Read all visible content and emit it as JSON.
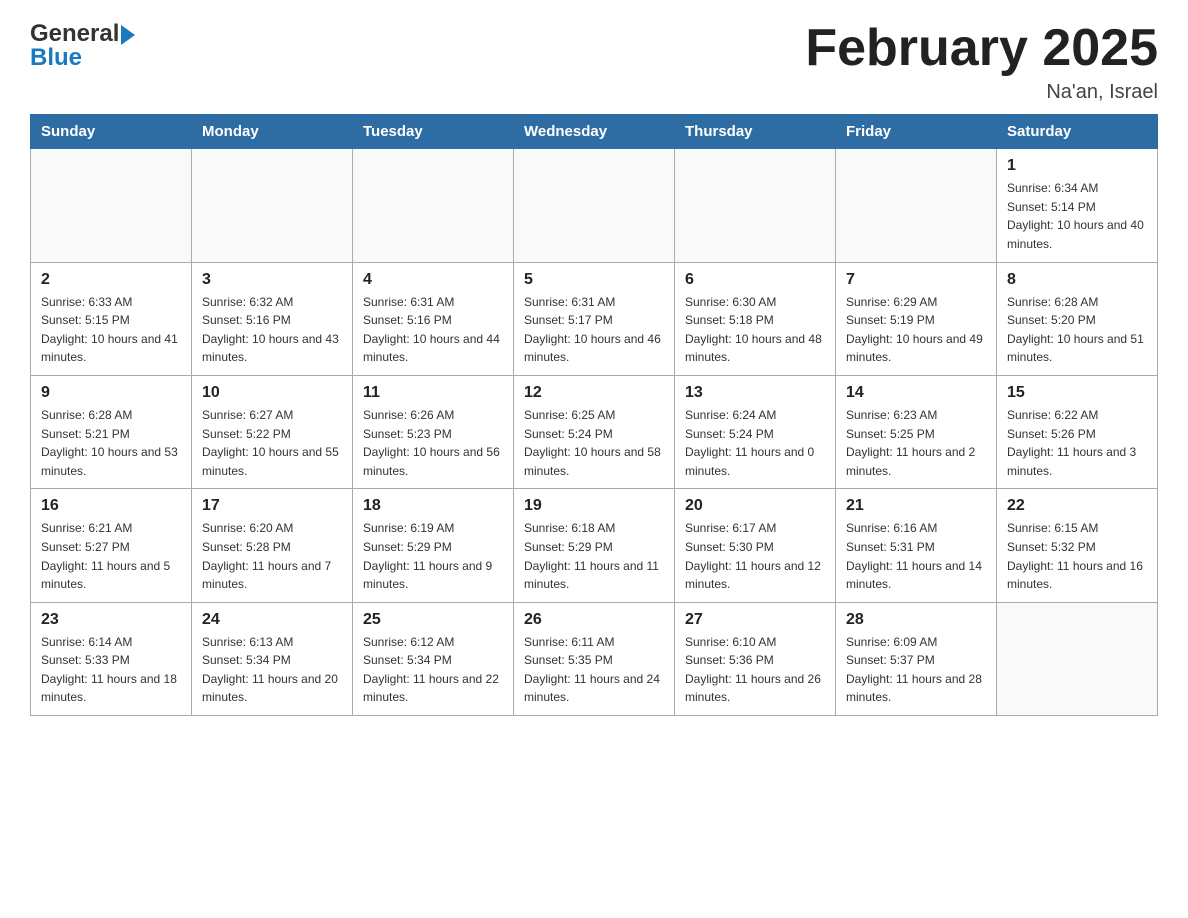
{
  "header": {
    "logo_general": "General",
    "logo_blue": "Blue",
    "month_title": "February 2025",
    "location": "Na'an, Israel"
  },
  "weekdays": [
    "Sunday",
    "Monday",
    "Tuesday",
    "Wednesday",
    "Thursday",
    "Friday",
    "Saturday"
  ],
  "weeks": [
    [
      {
        "day": "",
        "sunrise": "",
        "sunset": "",
        "daylight": ""
      },
      {
        "day": "",
        "sunrise": "",
        "sunset": "",
        "daylight": ""
      },
      {
        "day": "",
        "sunrise": "",
        "sunset": "",
        "daylight": ""
      },
      {
        "day": "",
        "sunrise": "",
        "sunset": "",
        "daylight": ""
      },
      {
        "day": "",
        "sunrise": "",
        "sunset": "",
        "daylight": ""
      },
      {
        "day": "",
        "sunrise": "",
        "sunset": "",
        "daylight": ""
      },
      {
        "day": "1",
        "sunrise": "Sunrise: 6:34 AM",
        "sunset": "Sunset: 5:14 PM",
        "daylight": "Daylight: 10 hours and 40 minutes."
      }
    ],
    [
      {
        "day": "2",
        "sunrise": "Sunrise: 6:33 AM",
        "sunset": "Sunset: 5:15 PM",
        "daylight": "Daylight: 10 hours and 41 minutes."
      },
      {
        "day": "3",
        "sunrise": "Sunrise: 6:32 AM",
        "sunset": "Sunset: 5:16 PM",
        "daylight": "Daylight: 10 hours and 43 minutes."
      },
      {
        "day": "4",
        "sunrise": "Sunrise: 6:31 AM",
        "sunset": "Sunset: 5:16 PM",
        "daylight": "Daylight: 10 hours and 44 minutes."
      },
      {
        "day": "5",
        "sunrise": "Sunrise: 6:31 AM",
        "sunset": "Sunset: 5:17 PM",
        "daylight": "Daylight: 10 hours and 46 minutes."
      },
      {
        "day": "6",
        "sunrise": "Sunrise: 6:30 AM",
        "sunset": "Sunset: 5:18 PM",
        "daylight": "Daylight: 10 hours and 48 minutes."
      },
      {
        "day": "7",
        "sunrise": "Sunrise: 6:29 AM",
        "sunset": "Sunset: 5:19 PM",
        "daylight": "Daylight: 10 hours and 49 minutes."
      },
      {
        "day": "8",
        "sunrise": "Sunrise: 6:28 AM",
        "sunset": "Sunset: 5:20 PM",
        "daylight": "Daylight: 10 hours and 51 minutes."
      }
    ],
    [
      {
        "day": "9",
        "sunrise": "Sunrise: 6:28 AM",
        "sunset": "Sunset: 5:21 PM",
        "daylight": "Daylight: 10 hours and 53 minutes."
      },
      {
        "day": "10",
        "sunrise": "Sunrise: 6:27 AM",
        "sunset": "Sunset: 5:22 PM",
        "daylight": "Daylight: 10 hours and 55 minutes."
      },
      {
        "day": "11",
        "sunrise": "Sunrise: 6:26 AM",
        "sunset": "Sunset: 5:23 PM",
        "daylight": "Daylight: 10 hours and 56 minutes."
      },
      {
        "day": "12",
        "sunrise": "Sunrise: 6:25 AM",
        "sunset": "Sunset: 5:24 PM",
        "daylight": "Daylight: 10 hours and 58 minutes."
      },
      {
        "day": "13",
        "sunrise": "Sunrise: 6:24 AM",
        "sunset": "Sunset: 5:24 PM",
        "daylight": "Daylight: 11 hours and 0 minutes."
      },
      {
        "day": "14",
        "sunrise": "Sunrise: 6:23 AM",
        "sunset": "Sunset: 5:25 PM",
        "daylight": "Daylight: 11 hours and 2 minutes."
      },
      {
        "day": "15",
        "sunrise": "Sunrise: 6:22 AM",
        "sunset": "Sunset: 5:26 PM",
        "daylight": "Daylight: 11 hours and 3 minutes."
      }
    ],
    [
      {
        "day": "16",
        "sunrise": "Sunrise: 6:21 AM",
        "sunset": "Sunset: 5:27 PM",
        "daylight": "Daylight: 11 hours and 5 minutes."
      },
      {
        "day": "17",
        "sunrise": "Sunrise: 6:20 AM",
        "sunset": "Sunset: 5:28 PM",
        "daylight": "Daylight: 11 hours and 7 minutes."
      },
      {
        "day": "18",
        "sunrise": "Sunrise: 6:19 AM",
        "sunset": "Sunset: 5:29 PM",
        "daylight": "Daylight: 11 hours and 9 minutes."
      },
      {
        "day": "19",
        "sunrise": "Sunrise: 6:18 AM",
        "sunset": "Sunset: 5:29 PM",
        "daylight": "Daylight: 11 hours and 11 minutes."
      },
      {
        "day": "20",
        "sunrise": "Sunrise: 6:17 AM",
        "sunset": "Sunset: 5:30 PM",
        "daylight": "Daylight: 11 hours and 12 minutes."
      },
      {
        "day": "21",
        "sunrise": "Sunrise: 6:16 AM",
        "sunset": "Sunset: 5:31 PM",
        "daylight": "Daylight: 11 hours and 14 minutes."
      },
      {
        "day": "22",
        "sunrise": "Sunrise: 6:15 AM",
        "sunset": "Sunset: 5:32 PM",
        "daylight": "Daylight: 11 hours and 16 minutes."
      }
    ],
    [
      {
        "day": "23",
        "sunrise": "Sunrise: 6:14 AM",
        "sunset": "Sunset: 5:33 PM",
        "daylight": "Daylight: 11 hours and 18 minutes."
      },
      {
        "day": "24",
        "sunrise": "Sunrise: 6:13 AM",
        "sunset": "Sunset: 5:34 PM",
        "daylight": "Daylight: 11 hours and 20 minutes."
      },
      {
        "day": "25",
        "sunrise": "Sunrise: 6:12 AM",
        "sunset": "Sunset: 5:34 PM",
        "daylight": "Daylight: 11 hours and 22 minutes."
      },
      {
        "day": "26",
        "sunrise": "Sunrise: 6:11 AM",
        "sunset": "Sunset: 5:35 PM",
        "daylight": "Daylight: 11 hours and 24 minutes."
      },
      {
        "day": "27",
        "sunrise": "Sunrise: 6:10 AM",
        "sunset": "Sunset: 5:36 PM",
        "daylight": "Daylight: 11 hours and 26 minutes."
      },
      {
        "day": "28",
        "sunrise": "Sunrise: 6:09 AM",
        "sunset": "Sunset: 5:37 PM",
        "daylight": "Daylight: 11 hours and 28 minutes."
      },
      {
        "day": "",
        "sunrise": "",
        "sunset": "",
        "daylight": ""
      }
    ]
  ]
}
